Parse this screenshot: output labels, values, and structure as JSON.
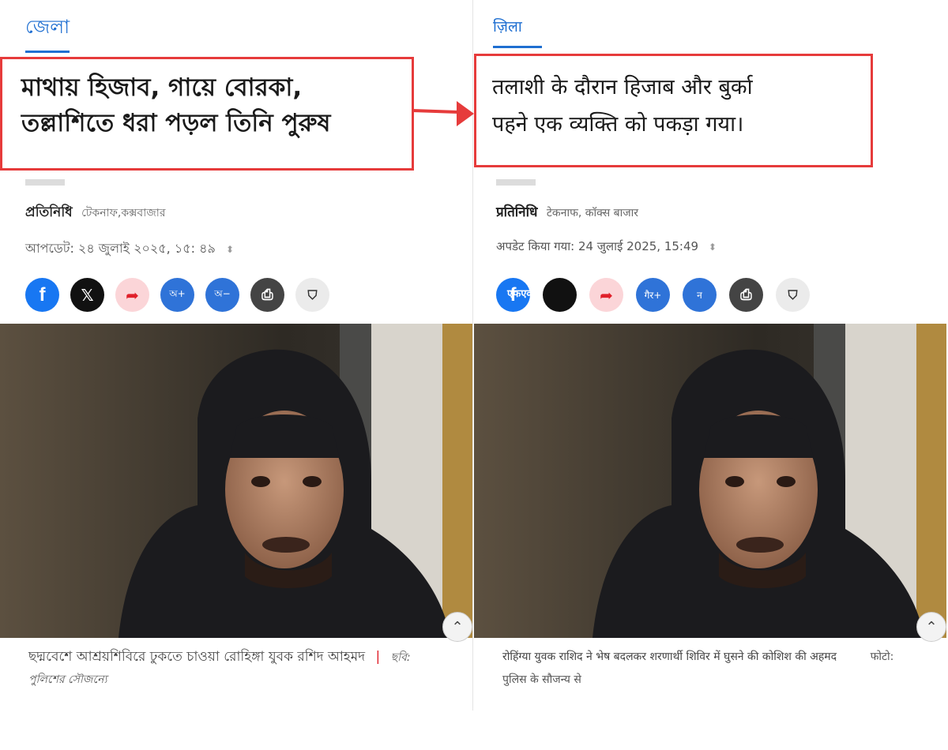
{
  "left": {
    "section_tab": "জেলা",
    "headline_line1": "মাথায় হিজাব, গায়ে বোরকা,",
    "headline_line2": "তল্লাশিতে ধরা পড়ল তিনি পুরুষ",
    "byline_author": "প্রতিনিধি",
    "byline_location": "টেকনাফ,কক্সবাজার",
    "updated": "আপডেট: ২৪ জুলাই ২০২৫, ১৫: ৪৯",
    "share_buttons": [
      {
        "icon": "facebook-icon",
        "label": "f"
      },
      {
        "icon": "x-icon",
        "label": "𝕏"
      },
      {
        "icon": "share-arrow-icon",
        "label": "➦"
      },
      {
        "icon": "font-increase-icon",
        "label": "অ+"
      },
      {
        "icon": "font-decrease-icon",
        "label": "অ−"
      },
      {
        "icon": "print-icon",
        "label": "⎙"
      },
      {
        "icon": "bookmark-icon",
        "label": "⛉"
      }
    ],
    "caption_text": "ছদ্মবেশে আশ্রয়শিবিরে ঢুকতে চাওয়া রোহিঙ্গা যুবক রশিদ আহমদ",
    "caption_sep": "|",
    "caption_credit": "ছবি: পুলিশের সৌজন্যে"
  },
  "right": {
    "section_tab": "ज़िला",
    "headline_line1": "तलाशी के दौरान हिजाब और बुर्का",
    "headline_line2": "पहने एक व्यक्ति को पकड़ा गया।",
    "byline_author": "प्रतिनिधि",
    "byline_location": "टेकनाफ, कॉक्स बाजार",
    "updated": "अपडेट किया गया: 24 जुलाई 2025, 15:49",
    "share_buttons": [
      {
        "icon": "facebook-icon",
        "label": "f",
        "overlay": "एफएक्स"
      },
      {
        "icon": "x-icon",
        "label": ""
      },
      {
        "icon": "share-arrow-icon",
        "label": "➦"
      },
      {
        "icon": "font-increase-icon",
        "label": "गैर+"
      },
      {
        "icon": "font-decrease-icon",
        "label": "न"
      },
      {
        "icon": "print-icon",
        "label": "⎙"
      },
      {
        "icon": "bookmark-icon",
        "label": "⛉"
      }
    ],
    "caption_text": "रोहिंग्या युवक राशिद ने भेष बदलकर शरणार्थी शिविर में घुसने की कोशिश की अहमद",
    "caption_credit": "फोटो: पुलिस के सौजन्य से"
  },
  "colors": {
    "highlight_border": "#e63b3b",
    "accent_blue": "#1f6fd1",
    "facebook": "#1877f2",
    "share_pink": "#fbd5d8"
  }
}
